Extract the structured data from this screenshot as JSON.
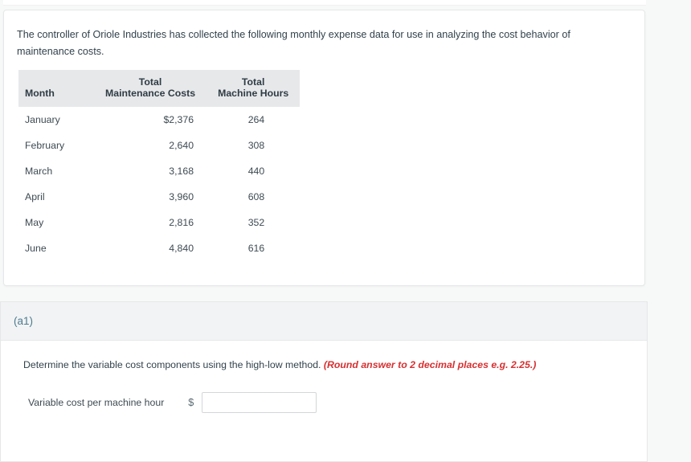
{
  "colors": {
    "page_background": "#f7f8f8",
    "card_background": "#ffffff",
    "card_border": "#e6e7e8",
    "table_header_background": "#e7e8ea",
    "body_text": "#32424c",
    "part_label_accent": "#4c7c91",
    "hint_red": "#d73032",
    "input_border": "#d4d6d8"
  },
  "stem": {
    "text": "The controller of Oriole Industries has collected the following monthly expense data for use in analyzing the cost behavior of maintenance costs."
  },
  "table": {
    "headers": {
      "month": "Month",
      "maintenance_line1": "Total",
      "maintenance_line2": "Maintenance Costs",
      "machine_hours_line1": "Total",
      "machine_hours_line2": "Machine Hours"
    },
    "rows": [
      {
        "month": "January",
        "maintenance_costs": "$2,376",
        "machine_hours": "264"
      },
      {
        "month": "February",
        "maintenance_costs": "2,640",
        "machine_hours": "308"
      },
      {
        "month": "March",
        "maintenance_costs": "3,168",
        "machine_hours": "440"
      },
      {
        "month": "April",
        "maintenance_costs": "3,960",
        "machine_hours": "608"
      },
      {
        "month": "May",
        "maintenance_costs": "2,816",
        "machine_hours": "352"
      },
      {
        "month": "June",
        "maintenance_costs": "4,840",
        "machine_hours": "616"
      }
    ]
  },
  "part": {
    "label": "(a1)",
    "instruction_main": "Determine the variable cost components using the high-low method.",
    "instruction_hint": "(Round answer to 2 decimal places e.g. 2.25.)",
    "answer": {
      "label": "Variable cost per machine hour",
      "currency_symbol": "$",
      "value": "",
      "placeholder": ""
    }
  }
}
